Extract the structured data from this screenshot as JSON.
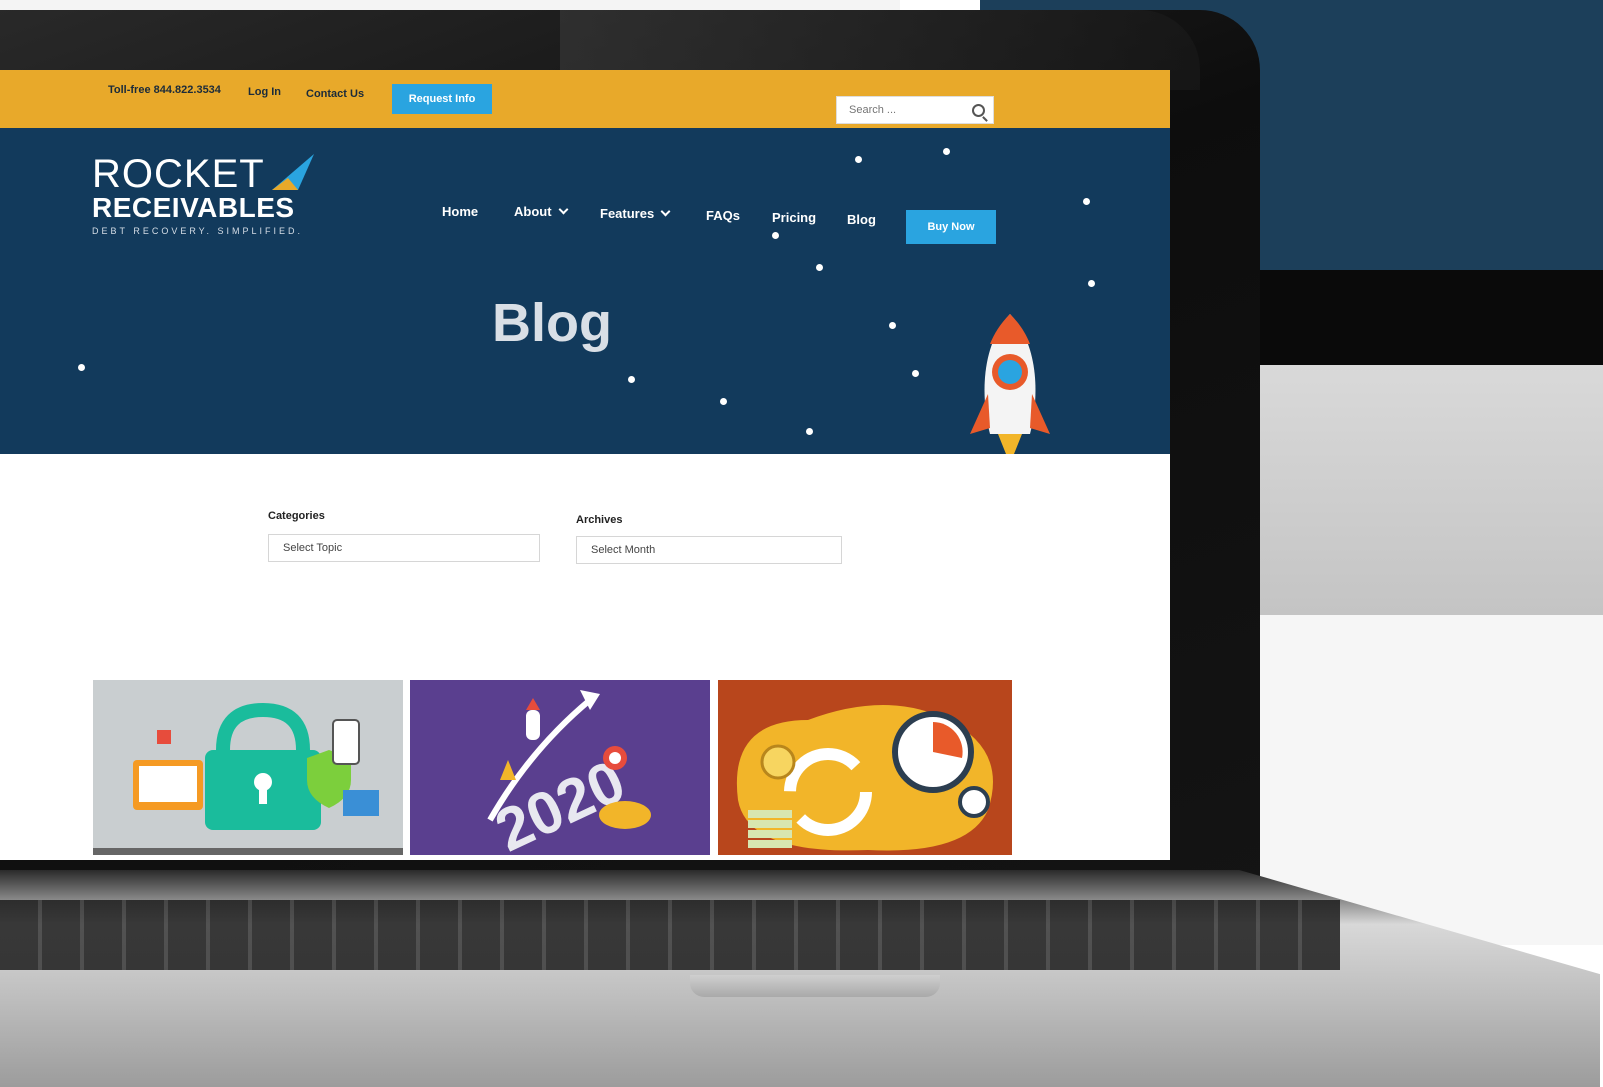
{
  "topbar": {
    "phone": "Toll-free 844.822.3534",
    "login": "Log In",
    "contact": "Contact Us",
    "request_btn": "Request Info",
    "search_placeholder": "Search ..."
  },
  "brand": {
    "line1": "ROCKET",
    "line2": "RECEIVABLES",
    "tagline": "DEBT RECOVERY. SIMPLIFIED.",
    "accent": "#2aa4e0",
    "accent2": "#e8a92a"
  },
  "nav": {
    "items": [
      {
        "label": "Home",
        "dropdown": false
      },
      {
        "label": "About",
        "dropdown": true
      },
      {
        "label": "Features",
        "dropdown": true
      },
      {
        "label": "FAQs",
        "dropdown": false
      },
      {
        "label": "Pricing",
        "dropdown": false
      },
      {
        "label": "Blog",
        "dropdown": false
      }
    ],
    "buy_btn": "Buy Now"
  },
  "hero": {
    "title": "Blog",
    "bg_color": "#123a5c"
  },
  "filters": {
    "categories_label": "Categories",
    "categories_value": "Select Topic",
    "archives_label": "Archives",
    "archives_value": "Select Month"
  },
  "cards": [
    {
      "icon": "security-lock-icon",
      "bg": "#c9ced0"
    },
    {
      "icon": "growth-2020-icon",
      "bg": "#5a3f8f"
    },
    {
      "icon": "cashflow-clock-icon",
      "bg": "#b8461c"
    }
  ]
}
